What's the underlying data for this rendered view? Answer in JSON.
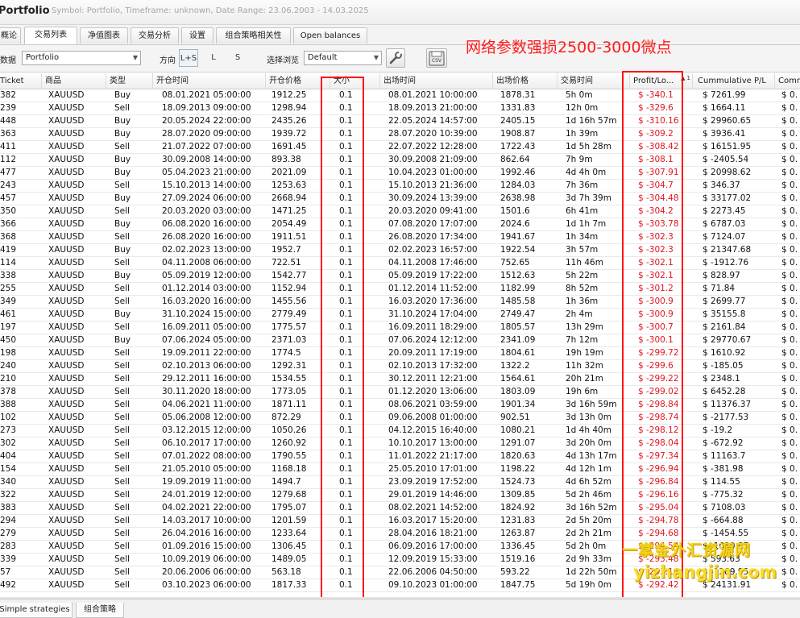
{
  "window": {
    "title": "Portfolio",
    "subtitle": "Symbol: Portfolio, Timeframe: unknown, Date Range: 23.06.2003 - 14.03.2025"
  },
  "tabs": [
    {
      "label": "概论"
    },
    {
      "label": "交易列表"
    },
    {
      "label": "净值图表"
    },
    {
      "label": "交易分析"
    },
    {
      "label": "设置"
    },
    {
      "label": "组合策略相关性"
    },
    {
      "label": "Open balances"
    }
  ],
  "toolbar": {
    "data_label": "数据",
    "data_value": "Portfolio",
    "direction_label": "方向",
    "directions": [
      "L+S",
      "L",
      "S"
    ],
    "browse_label": "选择浏览",
    "browse_value": "Default",
    "tool_icon": "wrench-icon",
    "export_icon": "csv-export-icon"
  },
  "annotation": "网络参数强损2500-3000微点",
  "columns": [
    "Ticket",
    "商品",
    "类型",
    "开仓时间",
    "开仓价格",
    "大小",
    "出场时间",
    "出场价格",
    "交易时间",
    "Profit/Lo...",
    "Cummulative P/L",
    "Comm"
  ],
  "sort_indicator": "▲ 1",
  "trades": [
    [
      "382",
      "XAUUSD",
      "Buy",
      "08.01.2021 05:00:00",
      "1912.25",
      "0.1",
      "08.01.2021 10:00:00",
      "1878.31",
      "5h 0m",
      "$ -340.1",
      "$ 7261.99",
      "$ 0."
    ],
    [
      "239",
      "XAUUSD",
      "Sell",
      "18.09.2013 09:00:00",
      "1298.94",
      "0.1",
      "18.09.2013 21:00:00",
      "1331.83",
      "12h 0m",
      "$ -329.6",
      "$ 1664.11",
      "$ 0."
    ],
    [
      "448",
      "XAUUSD",
      "Buy",
      "20.05.2024 22:00:00",
      "2435.26",
      "0.1",
      "22.05.2024 14:57:00",
      "2405.15",
      "1d 16h 57m",
      "$ -310.16",
      "$ 29960.65",
      "$ 0."
    ],
    [
      "363",
      "XAUUSD",
      "Buy",
      "28.07.2020 09:00:00",
      "1939.72",
      "0.1",
      "28.07.2020 10:39:00",
      "1908.87",
      "1h 39m",
      "$ -309.2",
      "$ 3936.41",
      "$ 0."
    ],
    [
      "411",
      "XAUUSD",
      "Sell",
      "21.07.2022 07:00:00",
      "1691.45",
      "0.1",
      "22.07.2022 12:28:00",
      "1722.43",
      "1d 5h 28m",
      "$ -308.42",
      "$ 16151.95",
      "$ 0."
    ],
    [
      "112",
      "XAUUSD",
      "Buy",
      "30.09.2008 14:00:00",
      "893.38",
      "0.1",
      "30.09.2008 21:09:00",
      "862.64",
      "7h 9m",
      "$ -308.1",
      "$ -2405.54",
      "$ 0."
    ],
    [
      "477",
      "XAUUSD",
      "Buy",
      "05.04.2023 21:00:00",
      "2021.09",
      "0.1",
      "10.04.2023 01:00:00",
      "1992.46",
      "4d 4h 0m",
      "$ -307.91",
      "$ 20998.62",
      "$ 0."
    ],
    [
      "243",
      "XAUUSD",
      "Sell",
      "15.10.2013 14:00:00",
      "1253.63",
      "0.1",
      "15.10.2013 21:36:00",
      "1284.03",
      "7h 36m",
      "$ -304.7",
      "$ 346.37",
      "$ 0."
    ],
    [
      "457",
      "XAUUSD",
      "Buy",
      "27.09.2024 06:00:00",
      "2668.94",
      "0.1",
      "30.09.2024 13:39:00",
      "2638.98",
      "3d 7h 39m",
      "$ -304.48",
      "$ 33177.02",
      "$ 0."
    ],
    [
      "350",
      "XAUUSD",
      "Sell",
      "20.03.2020 03:00:00",
      "1471.25",
      "0.1",
      "20.03.2020 09:41:00",
      "1501.6",
      "6h 41m",
      "$ -304.2",
      "$ 2273.45",
      "$ 0."
    ],
    [
      "366",
      "XAUUSD",
      "Buy",
      "06.08.2020 16:00:00",
      "2054.49",
      "0.1",
      "07.08.2020 17:07:00",
      "2024.6",
      "1d 1h 7m",
      "$ -303.78",
      "$ 6787.03",
      "$ 0."
    ],
    [
      "368",
      "XAUUSD",
      "Sell",
      "26.08.2020 16:00:00",
      "1911.51",
      "0.1",
      "26.08.2020 17:34:00",
      "1941.67",
      "1h 34m",
      "$ -302.3",
      "$ 7124.07",
      "$ 0."
    ],
    [
      "419",
      "XAUUSD",
      "Buy",
      "02.02.2023 13:00:00",
      "1952.7",
      "0.1",
      "02.02.2023 16:57:00",
      "1922.54",
      "3h 57m",
      "$ -302.3",
      "$ 21347.68",
      "$ 0."
    ],
    [
      "114",
      "XAUUSD",
      "Sell",
      "04.11.2008 06:00:00",
      "722.51",
      "0.1",
      "04.11.2008 17:46:00",
      "752.65",
      "11h 46m",
      "$ -302.1",
      "$ -1912.76",
      "$ 0."
    ],
    [
      "338",
      "XAUUSD",
      "Buy",
      "05.09.2019 12:00:00",
      "1542.77",
      "0.1",
      "05.09.2019 17:22:00",
      "1512.63",
      "5h 22m",
      "$ -302.1",
      "$ 828.97",
      "$ 0."
    ],
    [
      "255",
      "XAUUSD",
      "Sell",
      "01.12.2014 03:00:00",
      "1152.94",
      "0.1",
      "01.12.2014 11:52:00",
      "1182.99",
      "8h 52m",
      "$ -301.2",
      "$ 71.84",
      "$ 0."
    ],
    [
      "349",
      "XAUUSD",
      "Sell",
      "16.03.2020 16:00:00",
      "1455.56",
      "0.1",
      "16.03.2020 17:36:00",
      "1485.58",
      "1h 36m",
      "$ -300.9",
      "$ 2699.77",
      "$ 0."
    ],
    [
      "461",
      "XAUUSD",
      "Buy",
      "31.10.2024 15:00:00",
      "2779.49",
      "0.1",
      "31.10.2024 17:04:00",
      "2749.47",
      "2h 4m",
      "$ -300.9",
      "$ 35155.8",
      "$ 0."
    ],
    [
      "197",
      "XAUUSD",
      "Sell",
      "16.09.2011 05:00:00",
      "1775.57",
      "0.1",
      "16.09.2011 18:29:00",
      "1805.57",
      "13h 29m",
      "$ -300.7",
      "$ 2161.84",
      "$ 0."
    ],
    [
      "450",
      "XAUUSD",
      "Buy",
      "07.06.2024 05:00:00",
      "2371.03",
      "0.1",
      "07.06.2024 12:12:00",
      "2341.09",
      "7h 12m",
      "$ -300.1",
      "$ 29770.67",
      "$ 0."
    ],
    [
      "198",
      "XAUUSD",
      "Sell",
      "19.09.2011 22:00:00",
      "1774.5",
      "0.1",
      "20.09.2011 17:19:00",
      "1804.61",
      "19h 19m",
      "$ -299.72",
      "$ 1610.92",
      "$ 0."
    ],
    [
      "240",
      "XAUUSD",
      "Sell",
      "02.10.2013 06:00:00",
      "1292.31",
      "0.1",
      "02.10.2013 17:32:00",
      "1322.2",
      "11h 32m",
      "$ -299.6",
      "$ -185.05",
      "$ 0."
    ],
    [
      "210",
      "XAUUSD",
      "Sell",
      "29.12.2011 16:00:00",
      "1534.55",
      "0.1",
      "30.12.2011 12:21:00",
      "1564.61",
      "20h 21m",
      "$ -299.22",
      "$ 2348.1",
      "$ 0."
    ],
    [
      "378",
      "XAUUSD",
      "Sell",
      "30.11.2020 18:00:00",
      "1773.05",
      "0.1",
      "01.12.2020 13:06:00",
      "1803.09",
      "19h 6m",
      "$ -299.02",
      "$ 6452.28",
      "$ 0."
    ],
    [
      "388",
      "XAUUSD",
      "Sell",
      "04.06.2021 11:00:00",
      "1871.11",
      "0.1",
      "08.06.2021 03:59:00",
      "1901.34",
      "3d 16h 59m",
      "$ -298.84",
      "$ 11376.37",
      "$ 0."
    ],
    [
      "102",
      "XAUUSD",
      "Sell",
      "05.06.2008 12:00:00",
      "872.29",
      "0.1",
      "09.06.2008 01:00:00",
      "902.51",
      "3d 13h 0m",
      "$ -298.74",
      "$ -2177.53",
      "$ 0."
    ],
    [
      "273",
      "XAUUSD",
      "Sell",
      "03.12.2015 12:00:00",
      "1050.26",
      "0.1",
      "04.12.2015 16:40:00",
      "1080.21",
      "1d 4h 40m",
      "$ -298.12",
      "$ -19.2",
      "$ 0."
    ],
    [
      "302",
      "XAUUSD",
      "Sell",
      "06.10.2017 17:00:00",
      "1260.92",
      "0.1",
      "10.10.2017 13:00:00",
      "1291.07",
      "3d 20h 0m",
      "$ -298.04",
      "$ -672.92",
      "$ 0."
    ],
    [
      "404",
      "XAUUSD",
      "Sell",
      "07.01.2022 08:00:00",
      "1790.55",
      "0.1",
      "11.01.2022 21:17:00",
      "1820.63",
      "4d 13h 17m",
      "$ -297.34",
      "$ 11163.7",
      "$ 0."
    ],
    [
      "154",
      "XAUUSD",
      "Sell",
      "21.05.2010 05:00:00",
      "1168.18",
      "0.1",
      "25.05.2010 17:01:00",
      "1198.22",
      "4d 12h 1m",
      "$ -296.94",
      "$ -381.98",
      "$ 0."
    ],
    [
      "340",
      "XAUUSD",
      "Sell",
      "19.09.2019 11:00:00",
      "1494.7",
      "0.1",
      "23.09.2019 17:52:00",
      "1524.73",
      "4d 6h 52m",
      "$ -296.84",
      "$ 114.55",
      "$ 0."
    ],
    [
      "322",
      "XAUUSD",
      "Sell",
      "24.01.2019 12:00:00",
      "1279.68",
      "0.1",
      "29.01.2019 14:46:00",
      "1309.85",
      "5d 2h 46m",
      "$ -296.16",
      "$ -775.32",
      "$ 0."
    ],
    [
      "383",
      "XAUUSD",
      "Sell",
      "04.02.2021 22:00:00",
      "1795.07",
      "0.1",
      "08.02.2021 14:52:00",
      "1824.92",
      "3d 16h 52m",
      "$ -295.04",
      "$ 7108.03",
      "$ 0."
    ],
    [
      "294",
      "XAUUSD",
      "Sell",
      "14.03.2017 10:00:00",
      "1201.59",
      "0.1",
      "16.03.2017 15:20:00",
      "1231.83",
      "2d 5h 20m",
      "$ -294.78",
      "$ -664.88",
      "$ 0."
    ],
    [
      "279",
      "XAUUSD",
      "Sell",
      "26.04.2016 16:00:00",
      "1233.64",
      "0.1",
      "28.04.2016 18:21:00",
      "1263.87",
      "2d 2h 21m",
      "$ -294.68",
      "$ -1454.55",
      "$ 0."
    ],
    [
      "283",
      "XAUUSD",
      "Sell",
      "01.09.2016 15:00:00",
      "1306.45",
      "0.1",
      "06.09.2016 17:00:00",
      "1336.45",
      "5d 2h 0m",
      "$ -294.54",
      "$ -1030.87",
      "$ 0."
    ],
    [
      "339",
      "XAUUSD",
      "Sell",
      "10.09.2019 06:00:00",
      "1489.05",
      "0.1",
      "12.09.2019 15:33:00",
      "1519.16",
      "2d 9h 33m",
      "$ -293.48",
      "$ 593.63",
      "$ 0."
    ],
    [
      "57",
      "XAUUSD",
      "Sell",
      "20.06.2006 06:00:00",
      "563.18",
      "0.1",
      "22.06.2006 04:50:00",
      "593.22",
      "1d 22h 50m",
      "$ -293.14",
      "$ -1289.95",
      "$ 0."
    ],
    [
      "492",
      "XAUUSD",
      "Sell",
      "03.10.2023 06:00:00",
      "1817.33",
      "0.1",
      "09.10.2023 01:00:00",
      "1847.75",
      "5d 19h 0m",
      "$ -292.42",
      "$ 24131.91",
      "$ 0."
    ]
  ],
  "watermark": {
    "line1": "一掌金外汇资源网",
    "line2": "yizhangjin.com"
  },
  "bottom_tabs": [
    {
      "label": "Simple strategies"
    },
    {
      "label": "组合策略"
    }
  ]
}
